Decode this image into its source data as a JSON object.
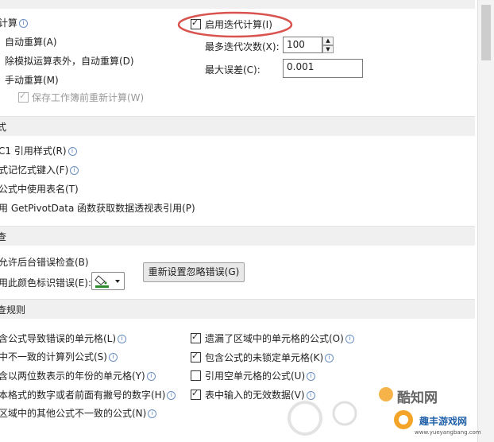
{
  "calc_section": {
    "workbook_calc_label": "计算",
    "auto_calc": "自动重算(A)",
    "auto_except_tables": "除模拟运算表外，自动重算(D)",
    "manual_calc": "手动重算(M)",
    "recalc_before_save": "保存工作簿前重新计算(W)",
    "enable_iterative": "启用迭代计算(I)",
    "enable_iterative_checked": true,
    "max_iterations_label": "最多迭代次数(X):",
    "max_iterations_value": "100",
    "max_change_label": "最大误差(C):",
    "max_change_value": "0.001"
  },
  "formula_section": {
    "header": "式",
    "r1c1": "C1 引用样式(R)",
    "formula_autocomplete": "式记忆式键入(F)",
    "table_names": "公式中使用表名(T)",
    "getpivotdata": "用 GetPivotData 函数获取数据透视表引用(P)"
  },
  "error_check_section": {
    "header": "查",
    "enable_background": "允许后台错误检查(B)",
    "indicate_color": "用此颜色标识错误(E):",
    "reset_ignored_button": "重新设置忽略错误(G)",
    "error_color": "#2e8b2e"
  },
  "rules_section": {
    "header": "查规则",
    "left_items": [
      "含公式导致错误的单元格(L)",
      "中不一致的计算列公式(S)",
      "含以两位数表示的年份的单元格(Y)",
      "本格式的数字或者前面有撇号的数字(H)",
      "区域中的其他公式不一致的公式(N)"
    ],
    "right_items": [
      {
        "label": "遗漏了区域中的单元格的公式(O)",
        "checked": true
      },
      {
        "label": "包含公式的未锁定单元格(K)",
        "checked": true
      },
      {
        "label": "引用空单元格的公式(U)",
        "checked": false
      },
      {
        "label": "表中输入的无效数据(V)",
        "checked": true
      }
    ]
  },
  "watermark": {
    "brand": "酷知网",
    "brand2": "趣丰游戏网",
    "url": "www.yueyangbang.com"
  },
  "colors": {
    "annotation_circle": "#d9534f",
    "section_bg": "#f0f0f0"
  }
}
